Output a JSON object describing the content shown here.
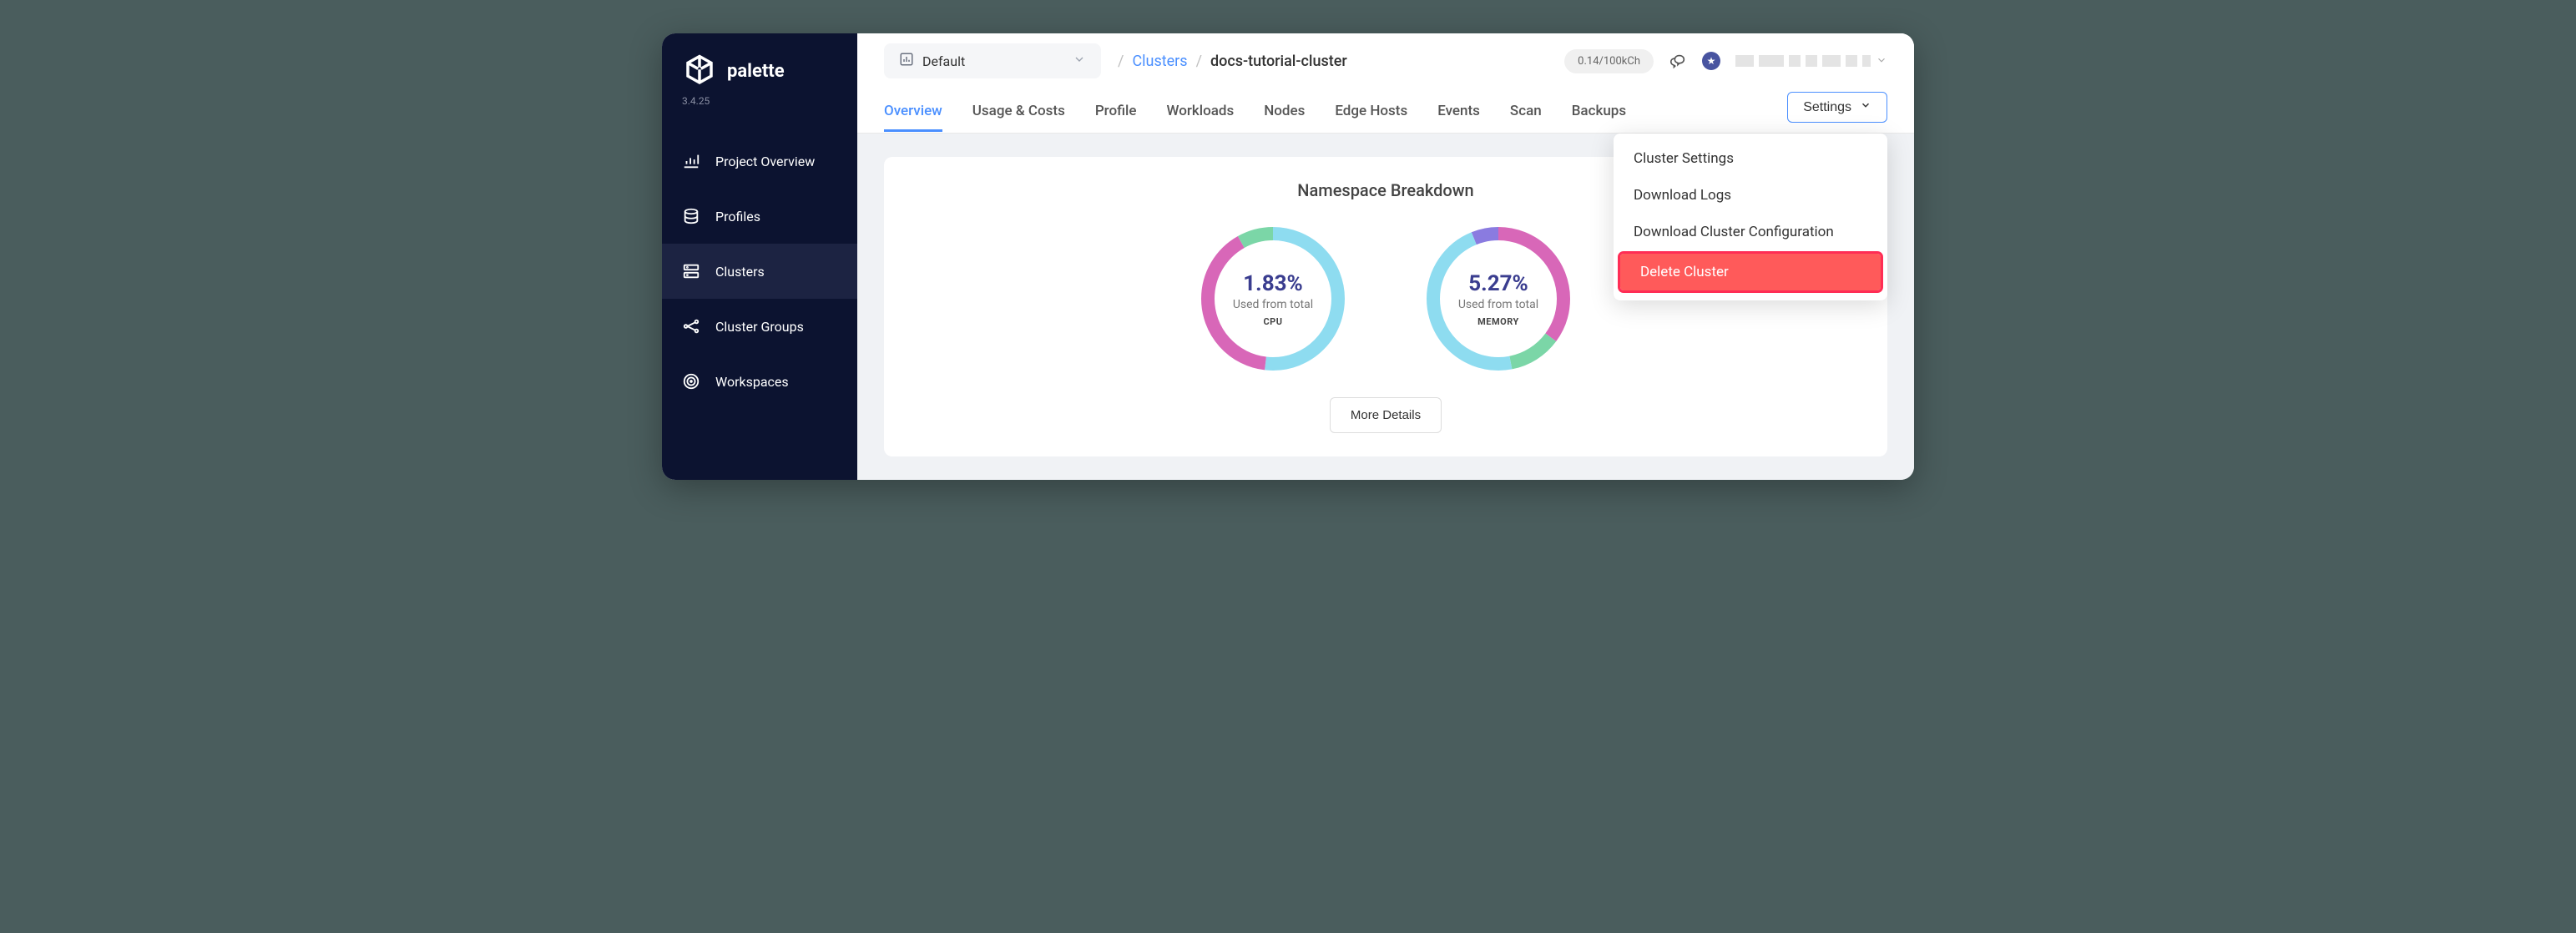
{
  "brand": {
    "name": "palette",
    "version": "3.4.25"
  },
  "sidebar": {
    "items": [
      {
        "label": "Project Overview"
      },
      {
        "label": "Profiles"
      },
      {
        "label": "Clusters"
      },
      {
        "label": "Cluster Groups"
      },
      {
        "label": "Workspaces"
      }
    ]
  },
  "project_selector": {
    "current": "Default"
  },
  "breadcrumb": {
    "parent": "Clusters",
    "current": "docs-tutorial-cluster"
  },
  "topbar": {
    "credits": "0.14/100kCh"
  },
  "tabs": [
    {
      "label": "Overview"
    },
    {
      "label": "Usage & Costs"
    },
    {
      "label": "Profile"
    },
    {
      "label": "Workloads"
    },
    {
      "label": "Nodes"
    },
    {
      "label": "Edge Hosts"
    },
    {
      "label": "Events"
    },
    {
      "label": "Scan"
    },
    {
      "label": "Backups"
    }
  ],
  "settings_button": "Settings",
  "settings_menu": [
    {
      "label": "Cluster Settings"
    },
    {
      "label": "Download Logs"
    },
    {
      "label": "Download Cluster Configuration"
    },
    {
      "label": "Delete Cluster"
    }
  ],
  "namespace_card": {
    "title": "Namespace Breakdown",
    "cpu": {
      "percent": "1.83%",
      "sub": "Used from total",
      "label": "CPU"
    },
    "memory": {
      "percent": "5.27%",
      "sub": "Used from total",
      "label": "MEMORY"
    },
    "more_button": "More Details"
  },
  "chart_data": [
    {
      "type": "pie",
      "title": "CPU Used from total",
      "series": [
        {
          "name": "used-segment-1",
          "value": 40,
          "color": "#d867b8"
        },
        {
          "name": "used-segment-2",
          "value": 8,
          "color": "#7bd6a7"
        },
        {
          "name": "unused",
          "value": 52,
          "color": "#8edcf0"
        }
      ],
      "center_value": 1.83,
      "center_unit": "%"
    },
    {
      "type": "pie",
      "title": "Memory Used from total",
      "series": [
        {
          "name": "used-segment-1",
          "value": 35,
          "color": "#d867b8"
        },
        {
          "name": "used-segment-2",
          "value": 12,
          "color": "#7bd6a7"
        },
        {
          "name": "used-segment-3",
          "value": 6,
          "color": "#8a7be0"
        },
        {
          "name": "unused",
          "value": 47,
          "color": "#8edcf0"
        }
      ],
      "center_value": 5.27,
      "center_unit": "%"
    }
  ]
}
